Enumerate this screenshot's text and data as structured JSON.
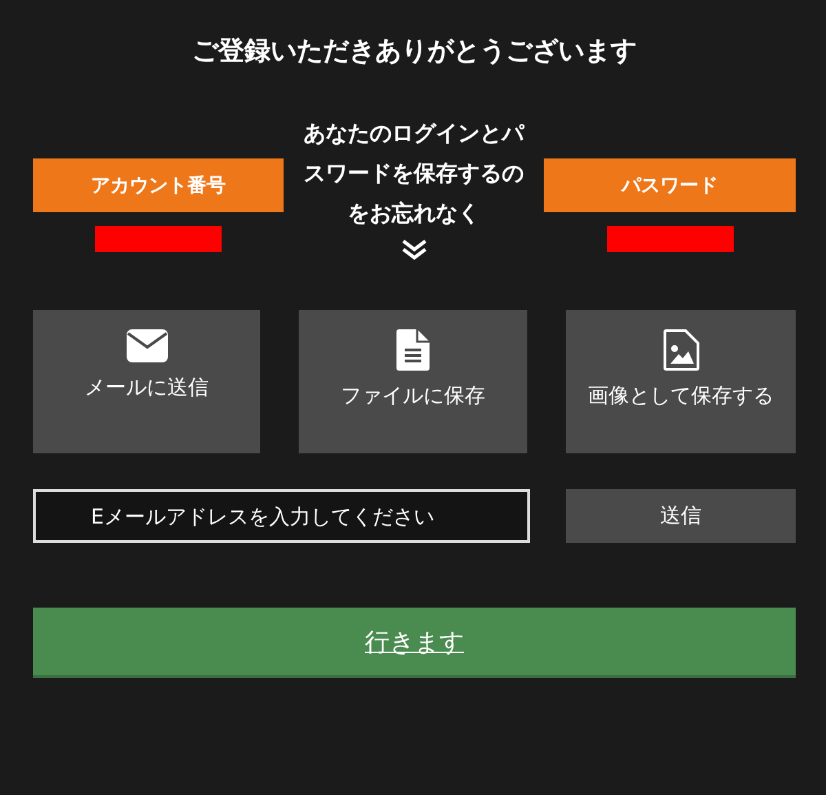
{
  "title": "ご登録いただきありがとうございます",
  "account_label": "アカウント番号",
  "message": "あなたのログインとパスワードを保存するのをお忘れなく",
  "password_label": "パスワード",
  "actions": [
    {
      "kind": "mail",
      "label": "メールに送信"
    },
    {
      "kind": "file",
      "label": "ファイルに保存"
    },
    {
      "kind": "image",
      "label": "画像として保存する"
    }
  ],
  "email_field": {
    "placeholder": "Eメールアドレスを入力してください"
  },
  "send_button": "送信",
  "go_button": "行きます"
}
